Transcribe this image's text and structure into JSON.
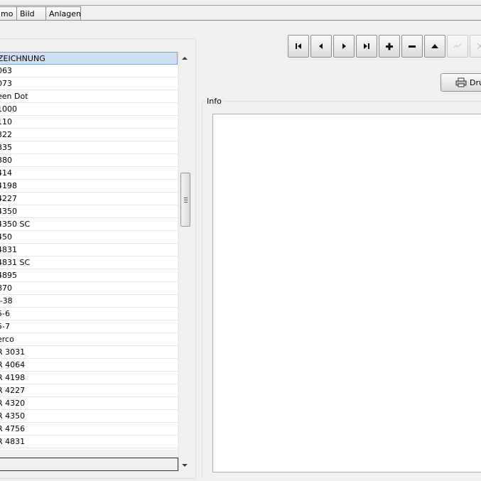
{
  "tabs": [
    {
      "label": "mo"
    },
    {
      "label": "Bild"
    },
    {
      "label": "Anlagen"
    }
  ],
  "list": {
    "header": "ZEICHNUNG",
    "items": [
      "063",
      "073",
      "een Dot",
      "1000",
      "110",
      "322",
      "335",
      "380",
      "414",
      "4198",
      "4227",
      "4350",
      "4350 SC",
      "450",
      "4831",
      "4831 SC",
      "4895",
      "870",
      "/-38",
      "5-6",
      "5-7",
      "erco",
      "R 3031",
      "R 4064",
      "R 4198",
      "R 4227",
      "R 4320",
      "R 4350",
      "R 4756",
      "R 4831"
    ]
  },
  "toolbar": [
    {
      "icon": "first-record-icon"
    },
    {
      "icon": "prior-record-icon"
    },
    {
      "icon": "next-record-icon"
    },
    {
      "icon": "last-record-icon"
    },
    {
      "icon": "plus-icon"
    },
    {
      "icon": "minus-icon"
    },
    {
      "icon": "up-triangle-icon"
    },
    {
      "icon": "check-icon"
    },
    {
      "icon": "cancel-icon"
    }
  ],
  "print_button": {
    "label": "Dru"
  },
  "info": {
    "label": "Info",
    "content": ""
  }
}
